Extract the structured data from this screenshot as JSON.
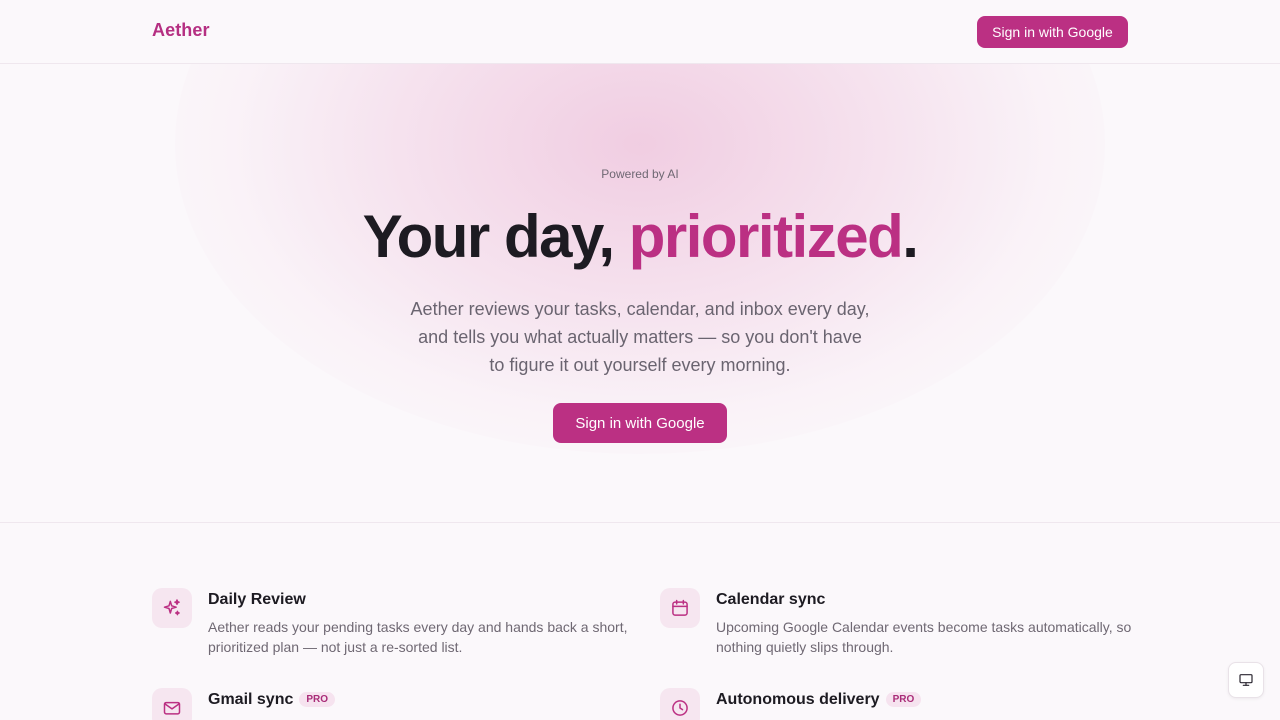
{
  "header": {
    "logo": "Aether",
    "signin_label": "Sign in with Google"
  },
  "hero": {
    "eyebrow": "Powered by AI",
    "headline_start": "Your day, ",
    "headline_accent": "prioritized",
    "headline_end": ".",
    "subtext": "Aether reviews your tasks, calendar, and inbox every day, and tells you what actually matters — so you don't have to figure it out yourself every morning.",
    "cta_label": "Sign in with Google"
  },
  "features": [
    {
      "icon": "sparkles-icon",
      "title": "Daily Review",
      "badge": "",
      "description": "Aether reads your pending tasks every day and hands back a short, prioritized plan — not just a re-sorted list."
    },
    {
      "icon": "calendar-icon",
      "title": "Calendar sync",
      "badge": "",
      "description": "Upcoming Google Calendar events become tasks automatically, so nothing quietly slips through."
    },
    {
      "icon": "mail-icon",
      "title": "Gmail sync",
      "badge": "PRO",
      "description": ""
    },
    {
      "icon": "clock-icon",
      "title": "Autonomous delivery",
      "badge": "PRO",
      "description": ""
    }
  ],
  "floating": {
    "icon": "monitor-icon"
  },
  "colors": {
    "accent": "#bb3083",
    "background": "#fbf8fb",
    "text": "#1d1b22",
    "muted": "#6f6873"
  }
}
